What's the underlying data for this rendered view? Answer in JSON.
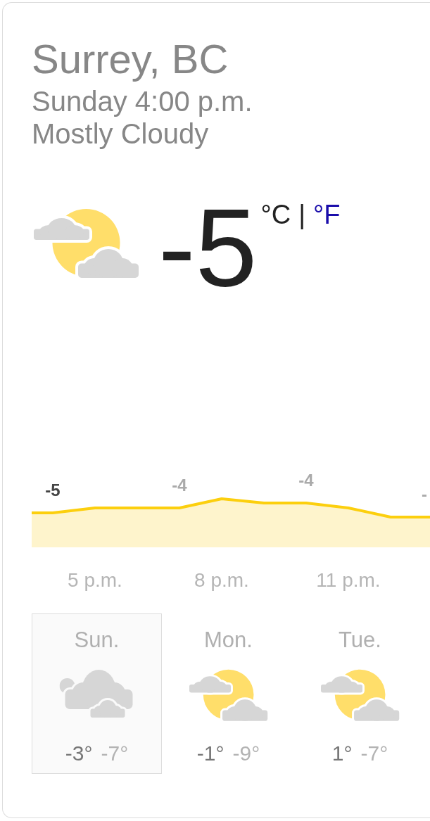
{
  "location": {
    "title": "Surrey, BC",
    "datetime": "Sunday 4:00 p.m.",
    "condition": "Mostly Cloudy"
  },
  "current": {
    "temperature": "-5",
    "units": [
      {
        "label": "°C",
        "selected": true
      },
      {
        "label": "°F",
        "selected": false
      }
    ],
    "separator": "|"
  },
  "hourly": {
    "temperatures": [
      {
        "label": "-5",
        "selected": true
      },
      {
        "label": "-4",
        "selected": false
      },
      {
        "label": "-4",
        "selected": false
      },
      {
        "label": "-",
        "selected": false
      }
    ],
    "times": [
      "5 p.m.",
      "8 p.m.",
      "11 p.m."
    ]
  },
  "daily": [
    {
      "day": "Sun.",
      "kind": "cloudy",
      "high": "-3°",
      "low": "-7°",
      "selected": true
    },
    {
      "day": "Mon.",
      "kind": "partly_cloudy",
      "high": "-1°",
      "low": "-9°",
      "selected": false
    },
    {
      "day": "Tue.",
      "kind": "partly_cloudy",
      "high": "1°",
      "low": "-7°",
      "selected": false
    }
  ]
}
